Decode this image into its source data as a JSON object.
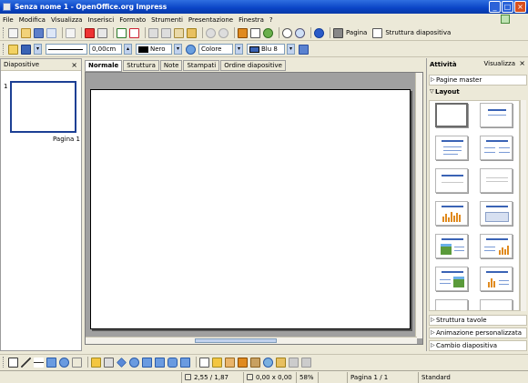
{
  "window": {
    "title": "Senza nome 1 - OpenOffice.org Impress",
    "buttons": {
      "minimize": "_",
      "maximize": "□",
      "close": "×"
    }
  },
  "menu": [
    "File",
    "Modifica",
    "Visualizza",
    "Inserisci",
    "Formato",
    "Strumenti",
    "Presentazione",
    "Finestra",
    "?"
  ],
  "toolbar": {
    "page_label": "Pagina",
    "slide_structure_label": "Struttura diapositiva"
  },
  "line_toolbar": {
    "line_width": "0,00cm",
    "line_color": "Nero",
    "area_style": "Colore",
    "area_color": "Blu 8"
  },
  "slides_pane": {
    "title": "Diapositive",
    "close": "×",
    "slide_number": "1",
    "slide_label": "Pagina 1"
  },
  "view_tabs": [
    "Normale",
    "Struttura",
    "Note",
    "Stampati",
    "Ordine diapositive"
  ],
  "tasks_pane": {
    "title": "Attività",
    "view_label": "Visualizza",
    "close": "×",
    "sections": {
      "master_pages": "Pagine master",
      "layout": "Layout",
      "table_design": "Struttura tavole",
      "custom_animation": "Animazione personalizzata",
      "slide_transition": "Cambio diapositiva"
    }
  },
  "status": {
    "position": "2,55 / 1,87",
    "size": "0,00 x 0,00",
    "zoom": "58%",
    "page": "Pagina 1 / 1",
    "layout_name": "Standard"
  },
  "colors": {
    "titlebar": "#0a44c6",
    "selection_border": "#1c3f94",
    "line_color_swatch": "#000000",
    "area_color_swatch": "#3a63b5"
  }
}
